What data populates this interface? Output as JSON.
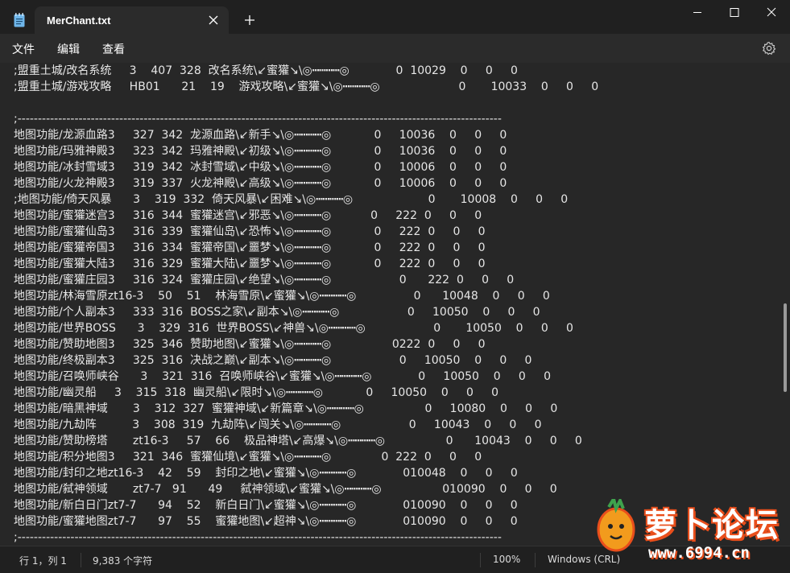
{
  "window": {
    "tab_title": "MerChant.txt",
    "new_tab_symbol": "+"
  },
  "menu": {
    "file": "文件",
    "edit": "编辑",
    "view": "查看"
  },
  "lines": [
    ";盟重土城/改名系统     3    407  328  改名系统\\↙蜜獾↘\\◎┅┅┅┅◎             0  10029    0     0     0",
    ";盟重土城/游戏攻略     HB01      21    19    游戏攻略\\↙蜜獾↘\\◎┅┅┅┅◎                      0       10033    0     0     0",
    "",
    ";-----------------------------------------------------------------------------------------------------------------------",
    "地图功能/龙源血路3     327  342  龙源血路\\↙新手↘\\◎┅┅┅┅◎            0     10036    0     0     0",
    "地图功能/玛雅神殿3     323  342  玛雅神殿\\↙初级↘\\◎┅┅┅┅◎            0     10036    0     0     0",
    "地图功能/冰封雪域3     319  342  冰封雪域\\↙中级↘\\◎┅┅┅┅◎            0     10006    0     0     0",
    "地图功能/火龙神殿3     319  337  火龙神殿\\↙高级↘\\◎┅┅┅┅◎            0     10006    0     0     0",
    ";地图功能/倚天风暴      3    319  332  倚天风暴\\↙困难↘\\◎┅┅┅┅◎                     0       10008    0     0     0",
    "地图功能/蜜獾迷宫3     316  344  蜜獾迷宫\\↙邪恶↘\\◎┅┅┅┅◎           0     222  0     0     0",
    "地图功能/蜜獾仙岛3     316  339  蜜獾仙岛\\↙恐怖↘\\◎┅┅┅┅◎            0     222  0     0     0",
    "地图功能/蜜獾帝国3     316  334  蜜獾帝国\\↙噩梦↘\\◎┅┅┅┅◎            0     222  0     0     0",
    "地图功能/蜜獾大陆3     316  329  蜜獾大陆\\↙噩梦↘\\◎┅┅┅┅◎            0     222  0     0     0",
    "地图功能/蜜獾庄园3     316  324  蜜獾庄园\\↙绝望↘\\◎┅┅┅┅◎                   0      222  0     0     0",
    "地图功能/林海雪原zt16-3    50    51    林海雪原\\↙蜜獾↘\\◎┅┅┅┅◎                0      10048    0     0     0",
    "地图功能/个人副本3     333  316  BOSS之家\\↙副本↘\\◎┅┅┅┅◎                   0     10050    0     0     0",
    "地图功能/世界BOSS      3    329  316  世界BOSS\\↙神兽↘\\◎┅┅┅┅◎                   0       10050    0     0     0",
    "地图功能/赞助地图3     325  346  赞助地图\\↙蜜獾↘\\◎┅┅┅┅◎                 0222  0     0     0",
    "地图功能/终极副本3     325  316  决战之巅\\↙副本↘\\◎┅┅┅┅◎                   0     10050    0     0     0",
    "地图功能/召唤师峡谷      3    321  316  召唤师峡谷\\↙蜜獾↘\\◎┅┅┅┅◎             0     10050    0     0     0",
    "地图功能/幽灵船     3    315  318  幽灵船\\↙限时↘\\◎┅┅┅┅◎            0     10050    0     0     0",
    "地图功能/暗黑神域       3    312  327  蜜獾神域\\↙新篇章↘\\◎┅┅┅┅◎                 0     10080    0     0     0",
    "地图功能/九劫阵          3    308  319  九劫阵\\↙闯关↘\\◎┅┅┅┅◎                   0     10043    0     0     0",
    "地图功能/赞助榜塔       zt16-3     57    66    极品神塔\\↙高爆↘\\◎┅┅┅┅◎                 0      10043    0     0     0",
    "地图功能/积分地图3     321  346  蜜獾仙境\\↙蜜獾↘\\◎┅┅┅┅◎              0  222  0     0     0",
    "地图功能/封印之地zt16-3    42    59    封印之地\\↙蜜獾↘\\◎┅┅┅┅◎             010048    0     0     0",
    "地图功能/弑神领域       zt7-7   91      49     弑神领域\\↙蜜獾↘\\◎┅┅┅┅◎                 010090    0     0     0",
    "地图功能/新白日门zt7-7      94    52    新白日门\\↙蜜獾↘\\◎┅┅┅┅◎             010090    0     0     0",
    "地图功能/蜜獾地图zt7-7      97    55    蜜獾地图\\↙超神↘\\◎┅┅┅┅◎             010090    0     0     0",
    ";-----------------------------------------------------------------------------------------------------------------------"
  ],
  "status": {
    "position": "行 1，列 1",
    "char_count": "9,383 个字符",
    "zoom": "100%",
    "line_ending": "Windows (CRL)"
  },
  "watermark": {
    "text": "萝卜论坛",
    "url": "www.6994.cn"
  }
}
